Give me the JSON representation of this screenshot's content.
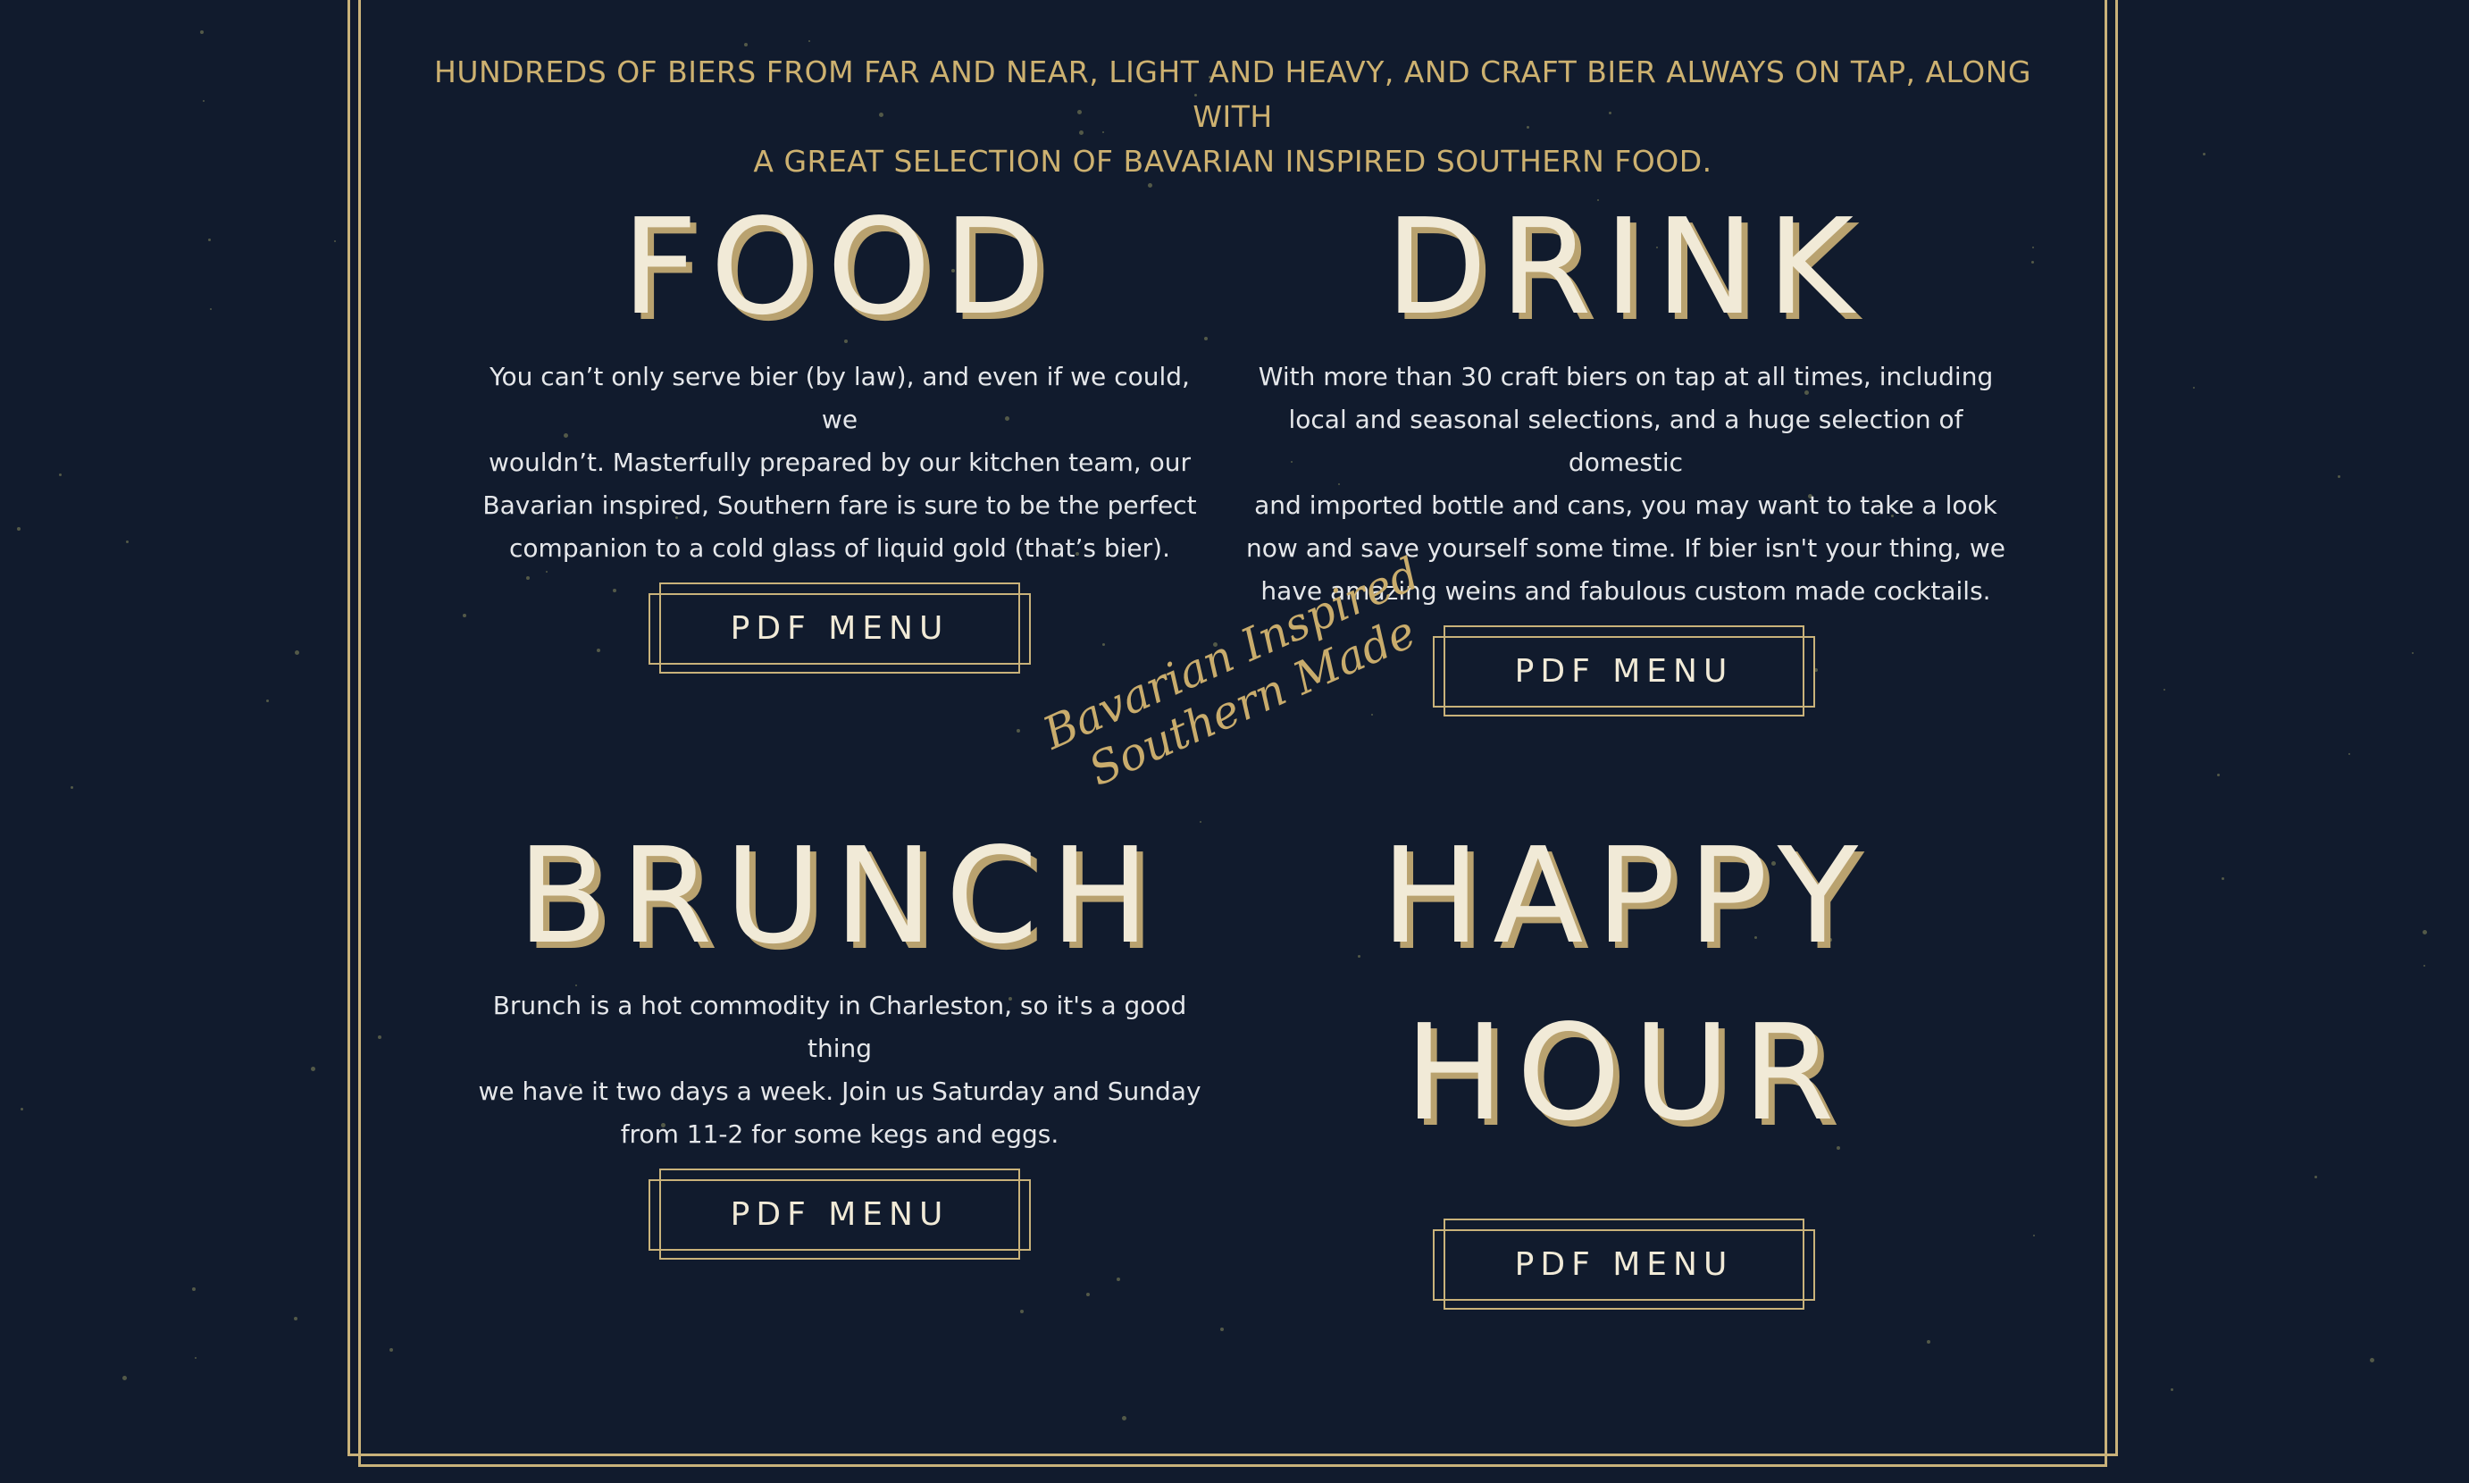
{
  "intro": {
    "line1": "HUNDREDS OF BIERS FROM FAR AND NEAR, LIGHT AND HEAVY, AND CRAFT BIER ALWAYS ON TAP, ALONG WITH",
    "line2": "A GREAT SELECTION OF BAVARIAN INSPIRED SOUTHERN FOOD."
  },
  "food": {
    "heading": "FOOD",
    "lines": [
      "You can’t only serve bier (by law), and even if we could, we",
      "wouldn’t. Masterfully prepared by our kitchen team, our",
      "Bavarian inspired, Southern fare is sure to be the perfect",
      "companion to a cold glass of liquid gold (that’s bier)."
    ],
    "button": "PDF MENU"
  },
  "drink": {
    "heading": "DRINK",
    "lines": [
      "With more than 30 craft biers on tap at all times, including",
      "local and seasonal selections, and a huge selection of domestic",
      "and imported bottle and cans, you may want to take a look",
      "now and save yourself some time. If bier isn't your thing, we",
      "have amazing weins and fabulous custom made cocktails."
    ],
    "button": "PDF MENU"
  },
  "brunch": {
    "heading": "BRUNCH",
    "lines": [
      "Brunch is a hot commodity in Charleston, so it's a good thing",
      "we have it two days a week. Join us Saturday and Sunday",
      "from 11-2 for some kegs and eggs."
    ],
    "button": "PDF MENU"
  },
  "happy_hour": {
    "heading_line1": "HAPPY",
    "heading_line2": "HOUR",
    "button": "PDF MENU"
  },
  "tagline": {
    "line1": "Bavarian Inspired",
    "line2": "Southern Made"
  },
  "colors": {
    "background": "#111b2d",
    "gold": "#c9b27a",
    "heading_cream": "#f1ead7",
    "heading_shadow": "#b9a26f",
    "body_text": "#e5e7ea"
  }
}
